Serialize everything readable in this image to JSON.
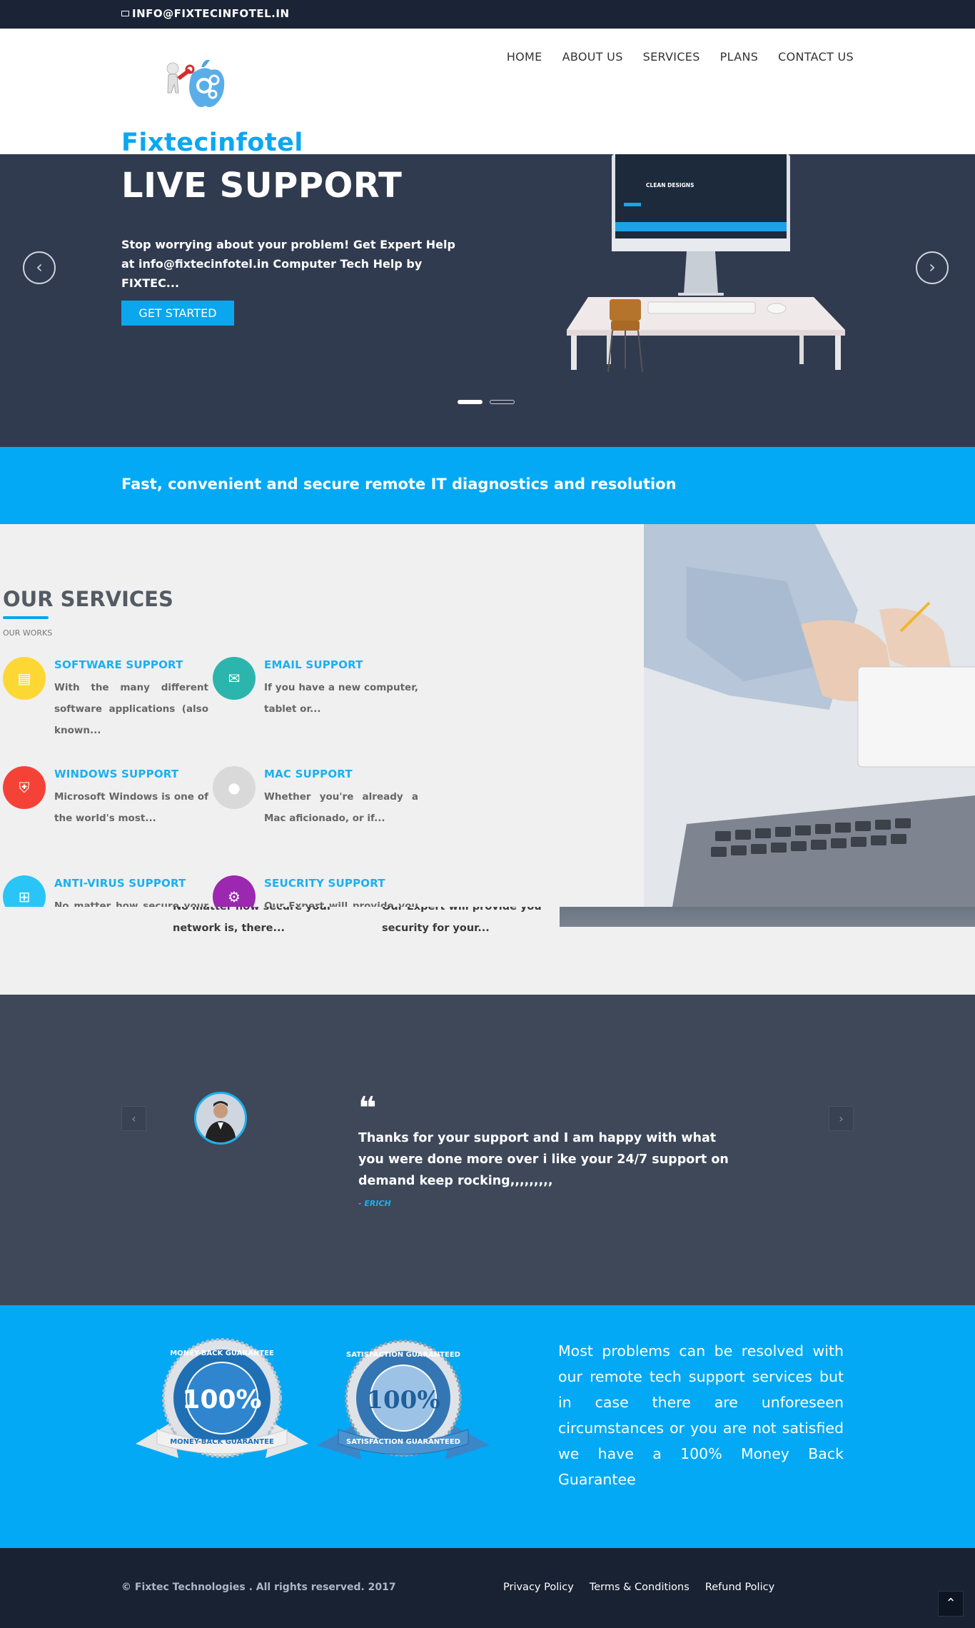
{
  "topbar": {
    "email": "INFO@FIXTECINFOTEL.IN",
    "icon": "envelope-icon"
  },
  "brand": {
    "name": "Fixtecinfotel",
    "color": "#0ba7ef"
  },
  "nav": {
    "items": [
      "HOME",
      "ABOUT US",
      "SERVICES",
      "PLANS",
      "CONTACT US"
    ]
  },
  "hero": {
    "title": "LIVE SUPPORT",
    "text": "Stop worrying about your problem! Get Expert Help at info@fixtecinfotel.in Computer Tech Help by FIXTEC...",
    "cta": "GET STARTED",
    "prev_icon": "chevron-left-icon",
    "next_icon": "chevron-right-icon",
    "slides": 2,
    "active_slide": 1,
    "monitor_headline": "CLEAN DESIGNS"
  },
  "tagline": "Fast, convenient and secure remote IT diagnostics and resolution",
  "services": {
    "title": "OUR SERVICES",
    "subtitle": "OUR WORKS",
    "items": [
      {
        "title": "SOFTWARE SUPPORT",
        "text": "With the many different software applications (also known...",
        "icon": "document-icon",
        "color": "#fdd835"
      },
      {
        "title": "EMAIL SUPPORT",
        "text": "If you have a new computer, tablet or...",
        "icon": "envelope-icon",
        "color": "#2bb5ad"
      },
      {
        "title": "WINDOWS SUPPORT",
        "text": "Microsoft Windows is one of the world's most...",
        "icon": "shield-icon",
        "color": "#f44336"
      },
      {
        "title": "MAC SUPPORT",
        "text": "Whether you're already a Mac aficionado, or if...",
        "icon": "apple-icon",
        "color": "#d9d9d9"
      },
      {
        "title": "ANTI-VIRUS SUPPORT",
        "text": "No matter how secure your network is, there...",
        "icon": "windows-icon",
        "color": "#29c5f6"
      },
      {
        "title": "SEUCRITY SUPPORT",
        "text": "Our Expert will provide you security for your...",
        "icon": "gear-icon",
        "color": "#9c27b0"
      }
    ],
    "ghost_lines": [
      "No matter how secure your",
      "network is, there...",
      "Our Expert will provide you",
      "security for your..."
    ]
  },
  "testimonial": {
    "quote": "Thanks for your support and I am happy with what you were done  more over i like your 24/7 support on demand keep rocking,,,,,,,,,",
    "author": "- ERICH",
    "quote_icon": "quote-icon",
    "prev_icon": "chevron-left-icon",
    "next_icon": "chevron-right-icon"
  },
  "guarantee": {
    "text": "Most problems can be resolved with our remote tech support services but in case there are unforeseen circumstances or you are not satisfied we have a 100% Money Back Guarantee",
    "badge1": {
      "ring": "MONEY-BACK GUARANTEE",
      "value": "100%",
      "ribbon": "MONEY-BACK GUARANTEE"
    },
    "badge2": {
      "ring": "SATISFACTION GUARANTEED",
      "value": "100%",
      "ribbon": "SATISFACTION GUARANTEED"
    }
  },
  "footer": {
    "copyright": "© Fixtec Technologies . All rights reserved. 2017",
    "links": [
      "Privacy Policy",
      "Terms & Conditions",
      "Refund Policy"
    ],
    "totop_icon": "chevron-up-icon"
  }
}
